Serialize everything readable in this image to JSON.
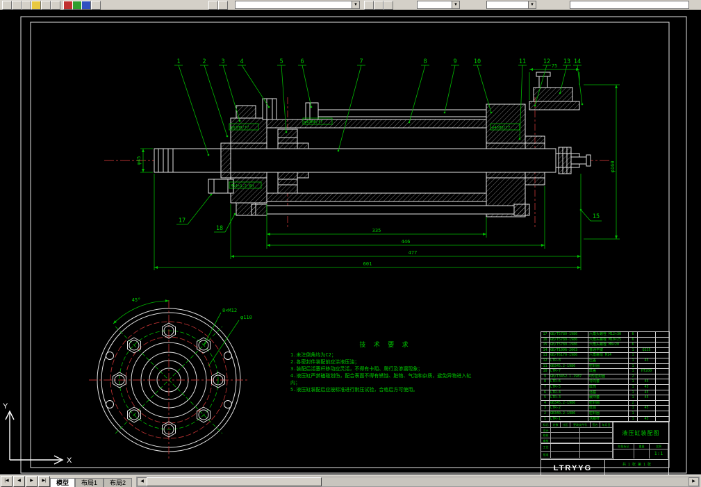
{
  "cad": {
    "callouts": [
      "1",
      "2",
      "3",
      "4",
      "5",
      "6",
      "7",
      "8",
      "9",
      "10",
      "11",
      "12",
      "13",
      "14",
      "15",
      "17",
      "18"
    ],
    "dims": {
      "bottom1": "335",
      "bottom2": "446",
      "bottom3": "477",
      "bottom4": "601",
      "right": "φ160",
      "top_right": "75",
      "rod": "φ45",
      "fit1": "φ63H8/f7",
      "fit2": "φ63H8/f7",
      "fit3": "M14×1.5-6H",
      "fit4": "φ45H8/f7"
    },
    "flange": {
      "angle": "45°",
      "holes": "8×M12",
      "dia": "φ110"
    },
    "tech": {
      "title": "技 术 要 求",
      "items": [
        "1.未注倒角均为C2；",
        "2.各密封件装配前应涂液压油；",
        "3.装配后活塞杆移动应灵活，不得有卡阻、爬行及渗漏现象；",
        "4.液压缸严禁磕碰划伤，配合表面不得有锈蚀、脏物、气泡和杂质，避免异物进入缸内；",
        "5.液压缸装配后应按标准进行耐压试验，合格后方可使用。"
      ]
    },
    "bom": {
      "rows": [
        {
          "no": "17",
          "code": "GB/T5780-1986",
          "name": "六角头螺栓 M12×30",
          "qty": "6",
          "mat": "",
          "note": ""
        },
        {
          "no": "16",
          "code": "GB/T5780-1986",
          "name": "六角头螺栓 M10×25",
          "qty": "6",
          "mat": "",
          "note": ""
        },
        {
          "no": "15",
          "code": "GB/T5780-1986",
          "name": "六角头螺栓 M8×20",
          "qty": "6",
          "mat": "",
          "note": ""
        },
        {
          "no": "14",
          "code": "GB/T1096-2003",
          "name": "普通平键",
          "qty": "1",
          "mat": "Q235",
          "note": ""
        },
        {
          "no": "13",
          "code": "GB/T6170-1986",
          "name": "六角螺母 M14",
          "qty": "1",
          "mat": "",
          "note": ""
        },
        {
          "no": "12",
          "code": "LTR-8",
          "name": "压盖",
          "qty": "1",
          "mat": "45",
          "note": ""
        },
        {
          "no": "11",
          "code": "GB345.2-1986",
          "name": "密封圈",
          "qty": "1",
          "mat": "",
          "note": ""
        },
        {
          "no": "10",
          "code": "LTR-7",
          "name": "缸盖",
          "qty": "1",
          "mat": "HT200",
          "note": ""
        },
        {
          "no": "9",
          "code": "GB/T3452.1-1987",
          "name": "O形密封圈",
          "qty": "2",
          "mat": "",
          "note": ""
        },
        {
          "no": "8",
          "code": "LTR-6",
          "name": "导向套",
          "qty": "1",
          "mat": "45",
          "note": ""
        },
        {
          "no": "7",
          "code": "LTR-5",
          "name": "缸筒",
          "qty": "1",
          "mat": "45",
          "note": ""
        },
        {
          "no": "6",
          "code": "LTR-4",
          "name": "活塞",
          "qty": "1",
          "mat": "45",
          "note": ""
        },
        {
          "no": "5",
          "code": "LTR-3",
          "name": "缓冲套",
          "qty": "1",
          "mat": "45",
          "note": ""
        },
        {
          "no": "4",
          "code": "GB345.2-1986",
          "name": "密封圈",
          "qty": "2",
          "mat": "",
          "note": ""
        },
        {
          "no": "3",
          "code": "LTR-2",
          "name": "缸底",
          "qty": "1",
          "mat": "45",
          "note": ""
        },
        {
          "no": "2",
          "code": "GB340.2-1986",
          "name": "密封圈",
          "qty": "1",
          "mat": "",
          "note": ""
        },
        {
          "no": "1",
          "code": "LTR-1",
          "name": "活塞杆",
          "qty": "1",
          "mat": "45",
          "note": ""
        }
      ]
    },
    "tb": {
      "code": "LTRYYG",
      "title": "液压缸装配图",
      "scale": "1:1",
      "sheet": "共 1 张  第 1 张",
      "h1": "标记",
      "h2": "处数",
      "h3": "分区",
      "h4": "更改文件号",
      "h5": "签名",
      "h6": "年月日",
      "r1": "设计",
      "r2": "校核",
      "r3": "审核",
      "r4": "工艺",
      "r5": "批准",
      "c1": "阶段标记",
      "c2": "重量",
      "c3": "比例"
    },
    "ucs": {
      "x": "X",
      "y": "Y"
    }
  },
  "tabs": {
    "nav1": "|◀",
    "nav2": "◀",
    "nav3": "▶",
    "nav4": "▶|",
    "t1": "模型",
    "t2": "布局1",
    "t3": "布局2"
  }
}
